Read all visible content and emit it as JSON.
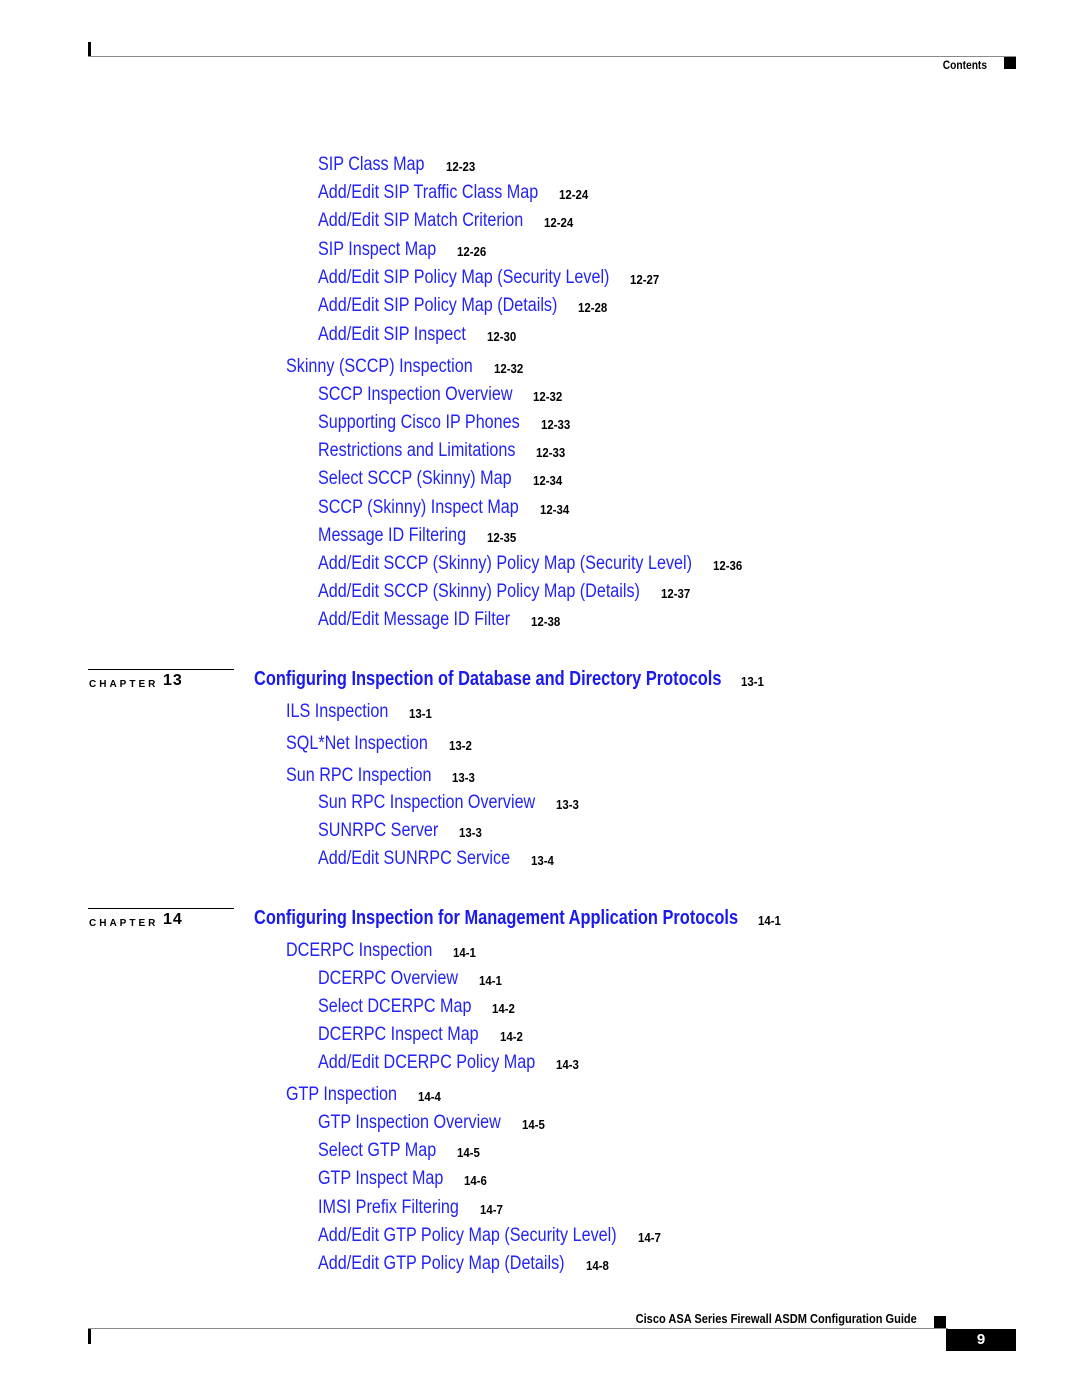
{
  "header": {
    "section_label": "Contents"
  },
  "groups": [
    {
      "entries": [
        {
          "level": 2,
          "title": "SIP Class Map",
          "page": "12-23"
        },
        {
          "level": 2,
          "title": "Add/Edit SIP Traffic Class Map",
          "page": "12-24"
        },
        {
          "level": 2,
          "title": "Add/Edit SIP Match Criterion",
          "page": "12-24"
        },
        {
          "level": 2,
          "title": "SIP Inspect Map",
          "page": "12-26"
        },
        {
          "level": 2,
          "title": "Add/Edit SIP Policy Map (Security Level)",
          "page": "12-27"
        },
        {
          "level": 2,
          "title": "Add/Edit SIP Policy Map (Details)",
          "page": "12-28"
        },
        {
          "level": 2,
          "title": "Add/Edit SIP Inspect",
          "page": "12-30"
        },
        {
          "level": 1,
          "title": "Skinny (SCCP) Inspection",
          "page": "12-32"
        },
        {
          "level": 2,
          "title": "SCCP Inspection Overview",
          "page": "12-32"
        },
        {
          "level": 2,
          "title": "Supporting Cisco IP Phones",
          "page": "12-33"
        },
        {
          "level": 2,
          "title": "Restrictions and Limitations",
          "page": "12-33"
        },
        {
          "level": 2,
          "title": "Select SCCP (Skinny) Map",
          "page": "12-34"
        },
        {
          "level": 2,
          "title": "SCCP (Skinny) Inspect Map",
          "page": "12-34"
        },
        {
          "level": 2,
          "title": "Message ID Filtering",
          "page": "12-35"
        },
        {
          "level": 2,
          "title": "Add/Edit SCCP (Skinny) Policy Map (Security Level)",
          "page": "12-36"
        },
        {
          "level": 2,
          "title": "Add/Edit SCCP (Skinny) Policy Map (Details)",
          "page": "12-37"
        },
        {
          "level": 2,
          "title": "Add/Edit Message ID Filter",
          "page": "12-38"
        }
      ]
    }
  ],
  "chapters": [
    {
      "label": "CHAPTER",
      "number": "13",
      "title": "Configuring Inspection of Database and Directory Protocols",
      "page": "13-1",
      "entries": [
        {
          "level": 1,
          "title": "ILS Inspection",
          "page": "13-1"
        },
        {
          "level": 1,
          "title": "SQL*Net Inspection",
          "page": "13-2"
        },
        {
          "level": 1,
          "title": "Sun RPC Inspection",
          "page": "13-3"
        },
        {
          "level": 2,
          "title": "Sun RPC Inspection Overview",
          "page": "13-3"
        },
        {
          "level": 2,
          "title": "SUNRPC Server",
          "page": "13-3"
        },
        {
          "level": 2,
          "title": "Add/Edit SUNRPC Service",
          "page": "13-4"
        }
      ]
    },
    {
      "label": "CHAPTER",
      "number": "14",
      "title": "Configuring Inspection for Management Application Protocols",
      "page": "14-1",
      "entries": [
        {
          "level": 1,
          "title": "DCERPC Inspection",
          "page": "14-1"
        },
        {
          "level": 2,
          "title": "DCERPC Overview",
          "page": "14-1"
        },
        {
          "level": 2,
          "title": "Select DCERPC Map",
          "page": "14-2"
        },
        {
          "level": 2,
          "title": "DCERPC Inspect Map",
          "page": "14-2"
        },
        {
          "level": 2,
          "title": "Add/Edit DCERPC Policy Map",
          "page": "14-3"
        },
        {
          "level": 1,
          "title": "GTP Inspection",
          "page": "14-4"
        },
        {
          "level": 2,
          "title": "GTP Inspection Overview",
          "page": "14-5"
        },
        {
          "level": 2,
          "title": "Select GTP Map",
          "page": "14-5"
        },
        {
          "level": 2,
          "title": "GTP Inspect Map",
          "page": "14-6"
        },
        {
          "level": 2,
          "title": "IMSI Prefix Filtering",
          "page": "14-7"
        },
        {
          "level": 2,
          "title": "Add/Edit GTP Policy Map (Security Level)",
          "page": "14-7"
        },
        {
          "level": 2,
          "title": "Add/Edit GTP Policy Map (Details)",
          "page": "14-8"
        }
      ]
    }
  ],
  "footer": {
    "book_title": "Cisco ASA Series Firewall ASDM Configuration Guide",
    "page_number": "9"
  }
}
